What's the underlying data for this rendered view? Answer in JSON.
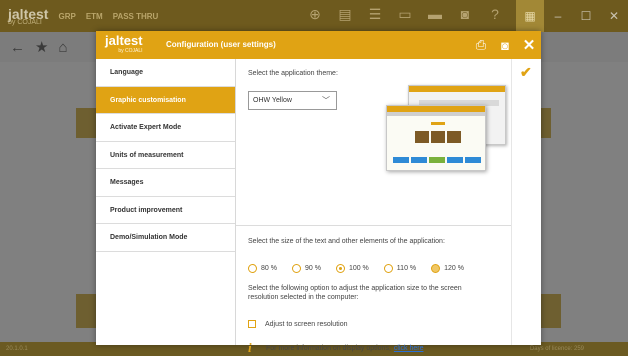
{
  "app": {
    "logo": "jaltest",
    "logo_sub": "by COJALI",
    "top_items": [
      "GRP",
      "ETM",
      "PASS THRU"
    ],
    "status_left": "20.1.0.1",
    "status_right": "Days of licence: 259"
  },
  "dialog": {
    "logo": "jaltest",
    "logo_sub": "by COJALI",
    "title": "Configuration (user settings)",
    "close": "✕"
  },
  "menu": {
    "items": [
      {
        "label": "Language",
        "active": false
      },
      {
        "label": "Graphic customisation",
        "active": true
      },
      {
        "label": "Activate Expert Mode",
        "active": false
      },
      {
        "label": "Units of measurement",
        "active": false
      },
      {
        "label": "Messages",
        "active": false
      },
      {
        "label": "Product improvement",
        "active": false
      },
      {
        "label": "Demo/Simulation Mode",
        "active": false
      }
    ]
  },
  "theme": {
    "label": "Select the application theme:",
    "selected": "OHW Yellow"
  },
  "size": {
    "label": "Select the size of the text and other elements of the application:",
    "options": [
      "80 %",
      "90 %",
      "100 %",
      "110 %",
      "120 %"
    ],
    "selected_index": 2,
    "adjust_label": "Select the following option to adjust the application size to the screen resolution selected in the computer:",
    "adjust_checkbox": "Adjust to screen resolution",
    "info_text": "For more information on display options,",
    "info_link": "click here"
  },
  "colors": {
    "accent": "#e0a314",
    "link": "#2a6fd6"
  }
}
